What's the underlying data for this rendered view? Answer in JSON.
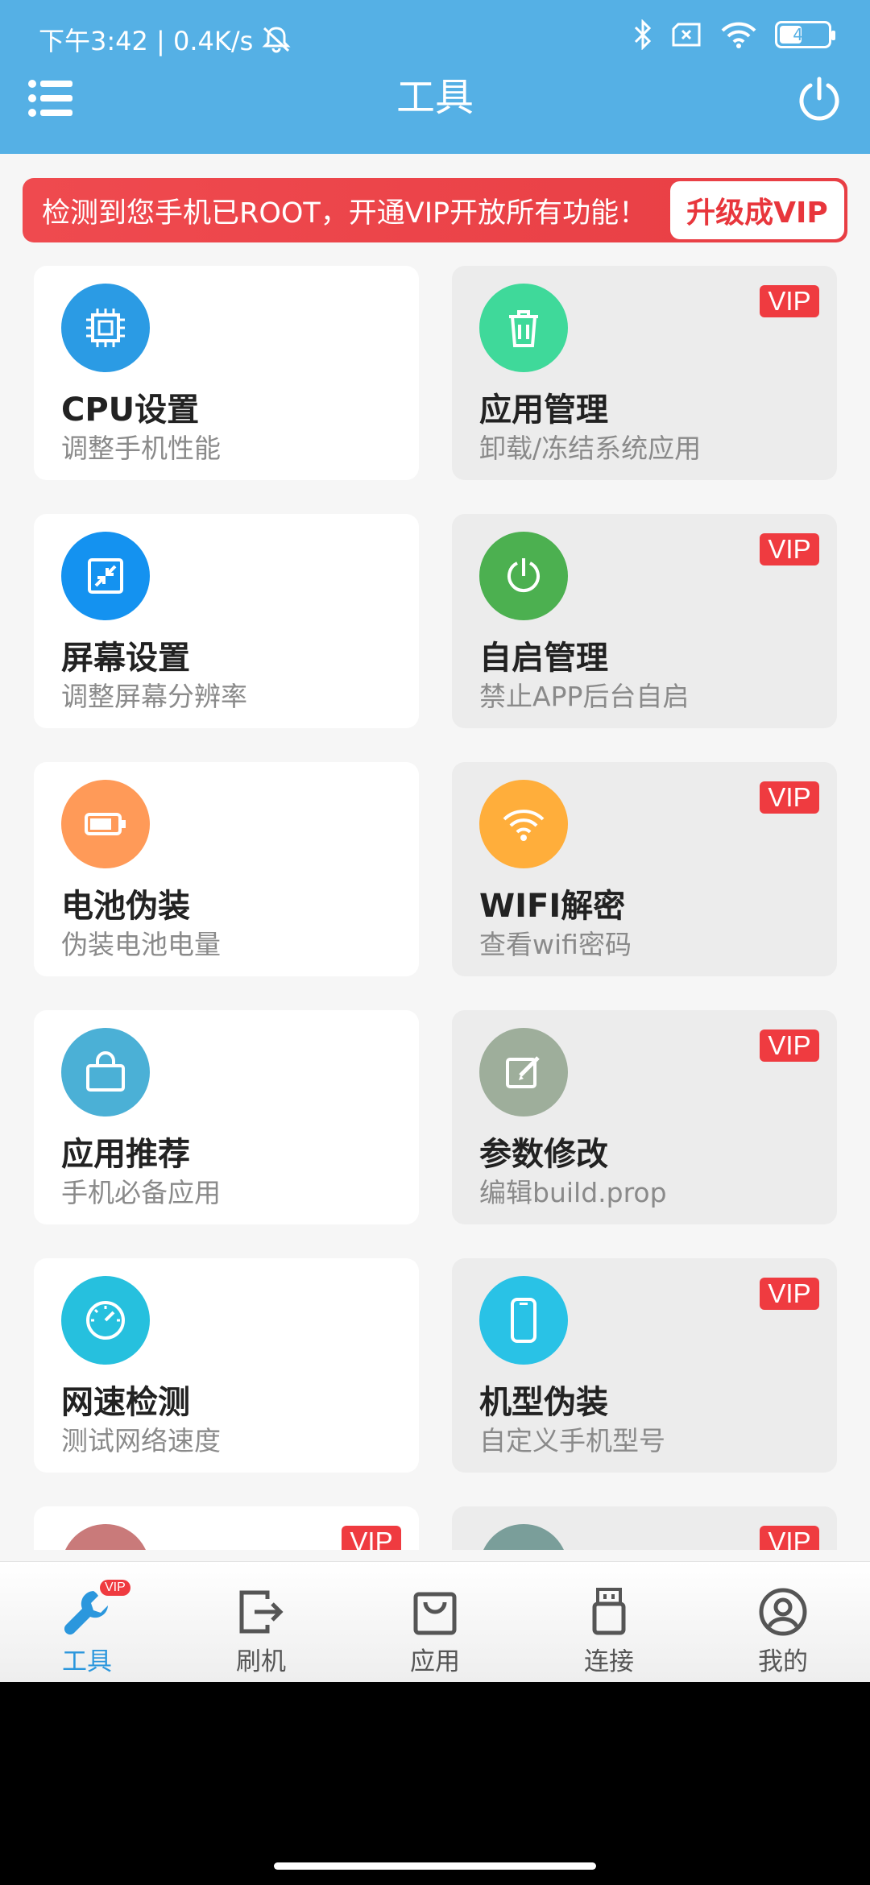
{
  "status_bar": {
    "time_speed": "下午3:42 | 0.4K/s",
    "battery": "42"
  },
  "header": {
    "title": "工具"
  },
  "banner": {
    "text": "检测到您手机已ROOT，开通VIP开放所有功能！",
    "button": "升级成VIP"
  },
  "vip_label": "VIP",
  "tools": [
    {
      "title": "CPU设置",
      "subtitle": "调整手机性能",
      "icon": "chip-icon",
      "color": "#2b9be4",
      "vip": false
    },
    {
      "title": "应用管理",
      "subtitle": "卸载/冻结系统应用",
      "icon": "trash-icon",
      "color": "#3fd99a",
      "vip": true
    },
    {
      "title": "屏幕设置",
      "subtitle": "调整屏幕分辨率",
      "icon": "shrink-screen-icon",
      "color": "#1492f0",
      "vip": false
    },
    {
      "title": "自启管理",
      "subtitle": "禁止APP后台自启",
      "icon": "power-cycle-icon",
      "color": "#4cb050",
      "vip": true
    },
    {
      "title": "电池伪装",
      "subtitle": "伪装电池电量",
      "icon": "battery-icon",
      "color": "#ff9a58",
      "vip": false
    },
    {
      "title": "WIFI解密",
      "subtitle": "查看wifi密码",
      "icon": "wifi-icon",
      "color": "#ffae3b",
      "vip": true
    },
    {
      "title": "应用推荐",
      "subtitle": "手机必备应用",
      "icon": "shopping-bag-icon",
      "color": "#4bb0d6",
      "vip": false
    },
    {
      "title": "参数修改",
      "subtitle": "编辑build.prop",
      "icon": "edit-icon",
      "color": "#9eae9b",
      "vip": true
    },
    {
      "title": "网速检测",
      "subtitle": "测试网络速度",
      "icon": "speedometer-icon",
      "color": "#26c0de",
      "vip": false
    },
    {
      "title": "机型伪装",
      "subtitle": "自定义手机型号",
      "icon": "phone-icon",
      "color": "#29c2e6",
      "vip": true
    }
  ],
  "partial_row_colors": [
    "#c97a7a",
    "#7a9e9a"
  ],
  "bottom_nav": {
    "items": [
      {
        "label": "工具",
        "icon": "wrench-icon",
        "active": true
      },
      {
        "label": "刷机",
        "icon": "flash-exit-icon",
        "active": false
      },
      {
        "label": "应用",
        "icon": "bag-icon",
        "active": false
      },
      {
        "label": "连接",
        "icon": "usb-icon",
        "active": false
      },
      {
        "label": "我的",
        "icon": "user-icon",
        "active": false
      }
    ],
    "badge": "VIP"
  },
  "colors": {
    "header_bg": "#55b0e5",
    "accent": "#2b97dd",
    "vip_red": "#ef3b40"
  }
}
